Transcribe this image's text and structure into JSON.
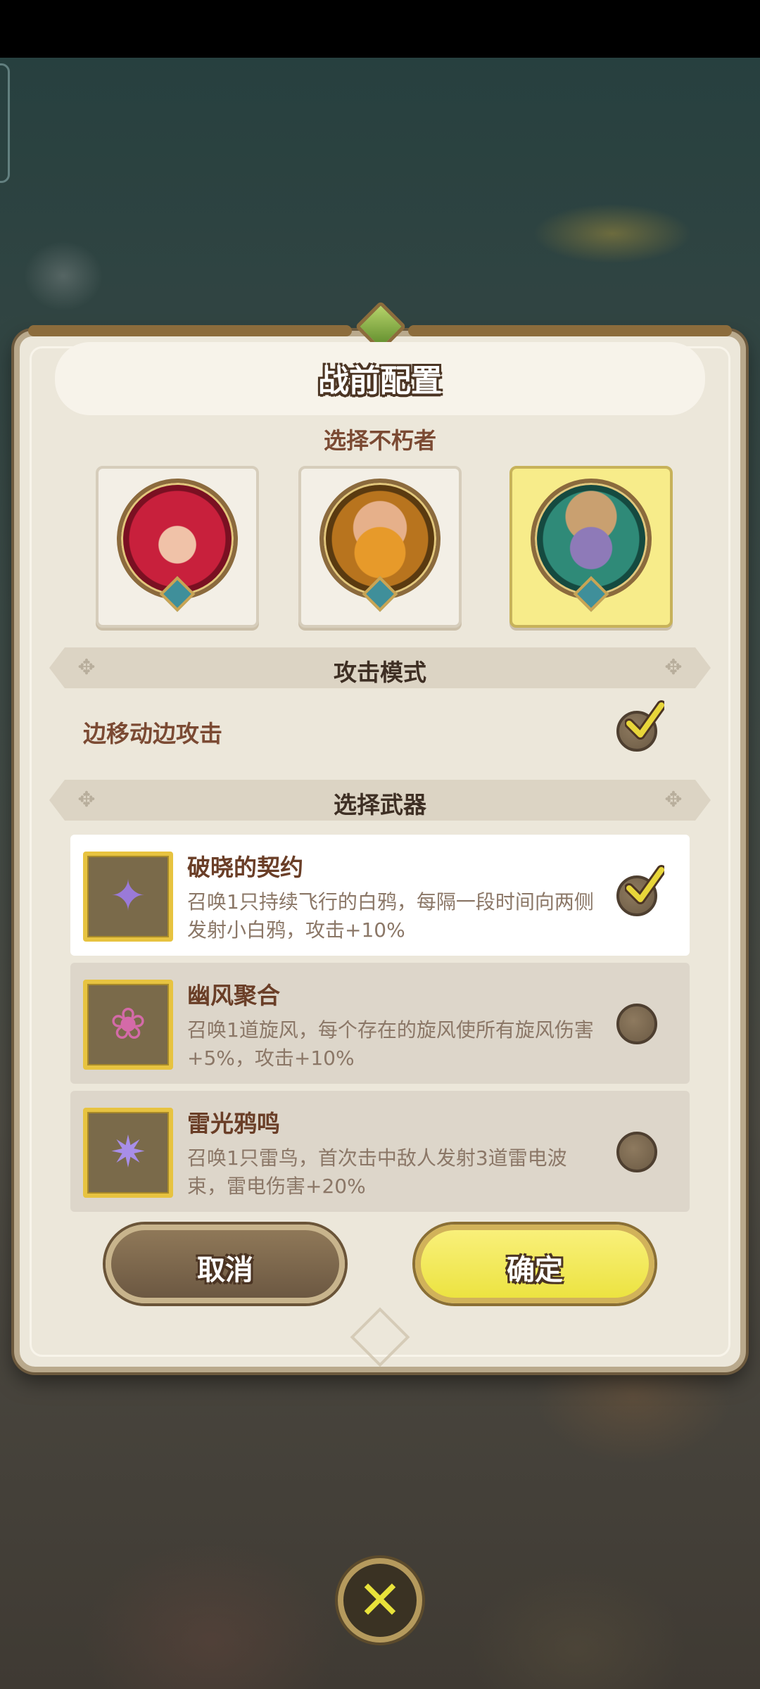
{
  "dialog": {
    "title": "战前配置",
    "hero_section_label": "选择不朽者",
    "heroes": [
      {
        "name": "red-hood-hero",
        "selected": false
      },
      {
        "name": "dwarf-hero",
        "selected": false
      },
      {
        "name": "dark-elf-hero",
        "selected": true
      }
    ],
    "attack_mode": {
      "banner": "攻击模式",
      "option_label": "边移动边攻击",
      "checked": true
    },
    "weapons_banner": "选择武器",
    "weapons": [
      {
        "name": "破晓的契约",
        "desc": "召唤1只持续飞行的白鸦，每隔一段时间向两侧发射小白鸦，攻击+10%",
        "selected": true,
        "icon": "crow-weapon-icon"
      },
      {
        "name": "幽风聚合",
        "desc": "召唤1道旋风，每个存在的旋风使所有旋风伤害+5%，攻击+10%",
        "selected": false,
        "icon": "wind-weapon-icon"
      },
      {
        "name": "雷光鸦鸣",
        "desc": "召唤1只雷鸟，首次击中敌人发射3道雷电波束，雷电伤害+20%",
        "selected": false,
        "icon": "thunder-weapon-icon"
      }
    ],
    "buttons": {
      "cancel": "取消",
      "confirm": "确定"
    }
  },
  "close": {
    "icon": "close-icon",
    "symbol": "✕"
  },
  "colors": {
    "panel": "#ece7da",
    "accent_yellow": "#f7ec8a",
    "title_brown": "#7b4a33",
    "check_tick": "#e8d63a"
  }
}
